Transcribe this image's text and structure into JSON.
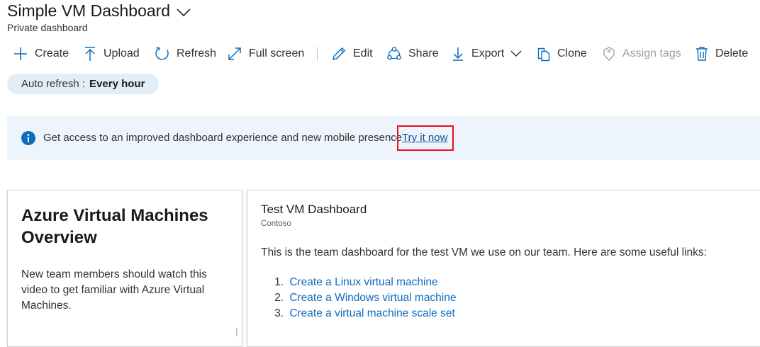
{
  "header": {
    "title": "Simple VM Dashboard",
    "subtitle": "Private dashboard",
    "title_menu_icon": "chevron-down-icon"
  },
  "toolbar": [
    {
      "id": "create",
      "label": "Create",
      "icon": "plus-icon",
      "enabled": true
    },
    {
      "id": "upload",
      "label": "Upload",
      "icon": "upload-icon",
      "enabled": true
    },
    {
      "id": "refresh",
      "label": "Refresh",
      "icon": "refresh-icon",
      "enabled": true
    },
    {
      "id": "fullscreen",
      "label": "Full screen",
      "icon": "expand-icon",
      "enabled": true
    },
    {
      "id": "edit",
      "label": "Edit",
      "icon": "pencil-icon",
      "enabled": true
    },
    {
      "id": "share",
      "label": "Share",
      "icon": "share-icon",
      "enabled": true
    },
    {
      "id": "export",
      "label": "Export",
      "icon": "download-icon",
      "enabled": true
    },
    {
      "id": "clone",
      "label": "Clone",
      "icon": "copy-icon",
      "enabled": true
    },
    {
      "id": "assign_tags",
      "label": "Assign tags",
      "icon": "tag-icon",
      "enabled": false
    },
    {
      "id": "delete",
      "label": "Delete",
      "icon": "trash-icon",
      "enabled": true
    }
  ],
  "auto_refresh": {
    "label": "Auto refresh :",
    "value": "Every hour"
  },
  "banner": {
    "icon": "info-icon",
    "text": "Get access to an improved dashboard experience and new mobile presence",
    "link": "Try it now"
  },
  "tiles": {
    "overview": {
      "title": "Azure Virtual Machines Overview",
      "body": "New team members should watch this video to get familiar with Azure Virtual Machines."
    },
    "test_vm": {
      "title": "Test VM Dashboard",
      "subtitle": "Contoso",
      "intro": "This is the team dashboard for the test VM we use on our team. Here are some useful links:",
      "links": [
        {
          "number": "1.",
          "text": "Create a Linux virtual machine"
        },
        {
          "number": "2.",
          "text": "Create a Windows virtual machine"
        },
        {
          "number": "3.",
          "text": "Create a virtual machine scale set"
        }
      ]
    }
  },
  "colors": {
    "accent": "#0f6cbd",
    "banner_bg": "#eef4fb",
    "highlight_box": "#e81123",
    "pill_bg": "#e1edf7"
  }
}
